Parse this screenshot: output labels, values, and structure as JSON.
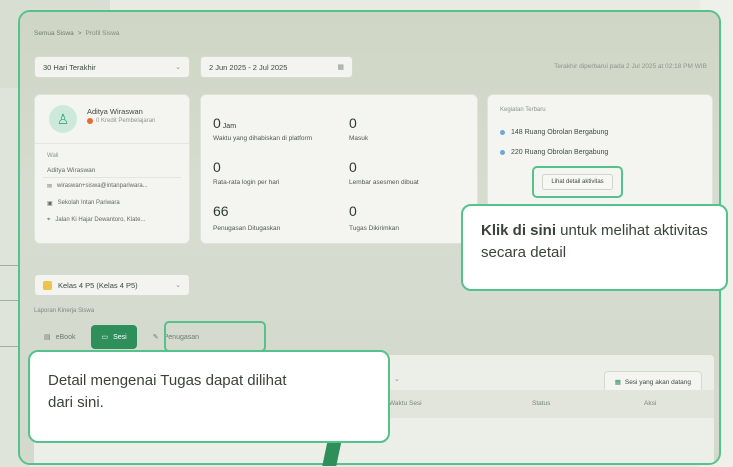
{
  "breadcrumb": {
    "parent": "Semua Siswa",
    "sep": ">",
    "current": "Profil Siswa"
  },
  "filters": {
    "range": "30 Hari Terakhir",
    "dates": "2 Jun 2025   - 2 Jul 2025"
  },
  "updated_text": "Terakhir diperbarui pada 2 Jul 2025 at 02:18 PM WIB",
  "profile": {
    "name": "Aditya Wiraswan",
    "credit": "0 Kredit Pembelajaran",
    "section_label": "Wali",
    "guardian": "Aditya Wiraswan",
    "email": "wiraswan+siswa@intanpariwara...",
    "school": "Sekolah Intan Pariwara",
    "address": "Jalan Ki Hajar Dewantoro, Klate..."
  },
  "stats": [
    {
      "value": "0",
      "unit": "Jam",
      "label": "Waktu yang dihabiskan di platform"
    },
    {
      "value": "0",
      "label": "Masuk"
    },
    {
      "value": "0",
      "label": "Rata-rata login per hari"
    },
    {
      "value": "0",
      "label": "Lembar asesmen dibuat"
    },
    {
      "value": "66",
      "label": "Penugasan Ditugaskan"
    },
    {
      "value": "0",
      "label": "Tugas Dikirimkan"
    }
  ],
  "activity": {
    "title": "Kegiatan Terbaru",
    "items": [
      "148 Ruang Obrolan Bergabung",
      "220 Ruang Obrolan Bergabung"
    ],
    "detail_button": "Lihat detail aktivitas"
  },
  "callout_activity": {
    "bold": "Klik di sini",
    "rest": " untuk melihat aktivitas secara detail"
  },
  "class_select": "Kelas 4 P5 (Kelas 4 P5)",
  "report_label": "Laporan Kinerja Siswa",
  "tabs": [
    "eBook",
    "Sesi",
    "Penugasan"
  ],
  "upcoming_button": "Sesi yang akan datang",
  "table_headers": [
    "Waktu Sesi",
    "Status",
    "Aksi"
  ],
  "callout_tasks": "Detail mengenai Tugas dapat dilihat dari sini.",
  "colors": {
    "accent": "#56c28b",
    "primary": "#2f8f5a"
  }
}
